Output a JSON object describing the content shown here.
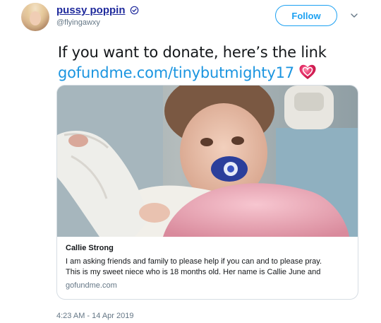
{
  "header": {
    "display_name": "pussy poppin",
    "verified_icon": "verified-badge-icon",
    "handle": "@flyingawxy",
    "follow_label": "Follow",
    "menu_icon": "chevron-down-icon"
  },
  "tweet": {
    "text_line1": "If you want to donate, here’s the link",
    "link_text": "gofundme.com/tinybutmighty17",
    "emoji": "heart-icon",
    "emoji_color": "#e0245e"
  },
  "card": {
    "image": "photo of a toddler with a blue pacifier and bandaged hand under a pink blanket",
    "title": "Callie Strong",
    "desc_line1": "I am asking friends and family to please help if you can and to please pray.",
    "desc_line2": "This is my sweet niece who is 18 months old. Her name is Callie June and",
    "domain": "gofundme.com"
  },
  "footer": {
    "timestamp": "4:23 AM - 14 Apr 2019"
  },
  "colors": {
    "accent": "#1da1f2",
    "link": "#1b95e0",
    "name": "#1f2a9c",
    "muted": "#657786"
  }
}
